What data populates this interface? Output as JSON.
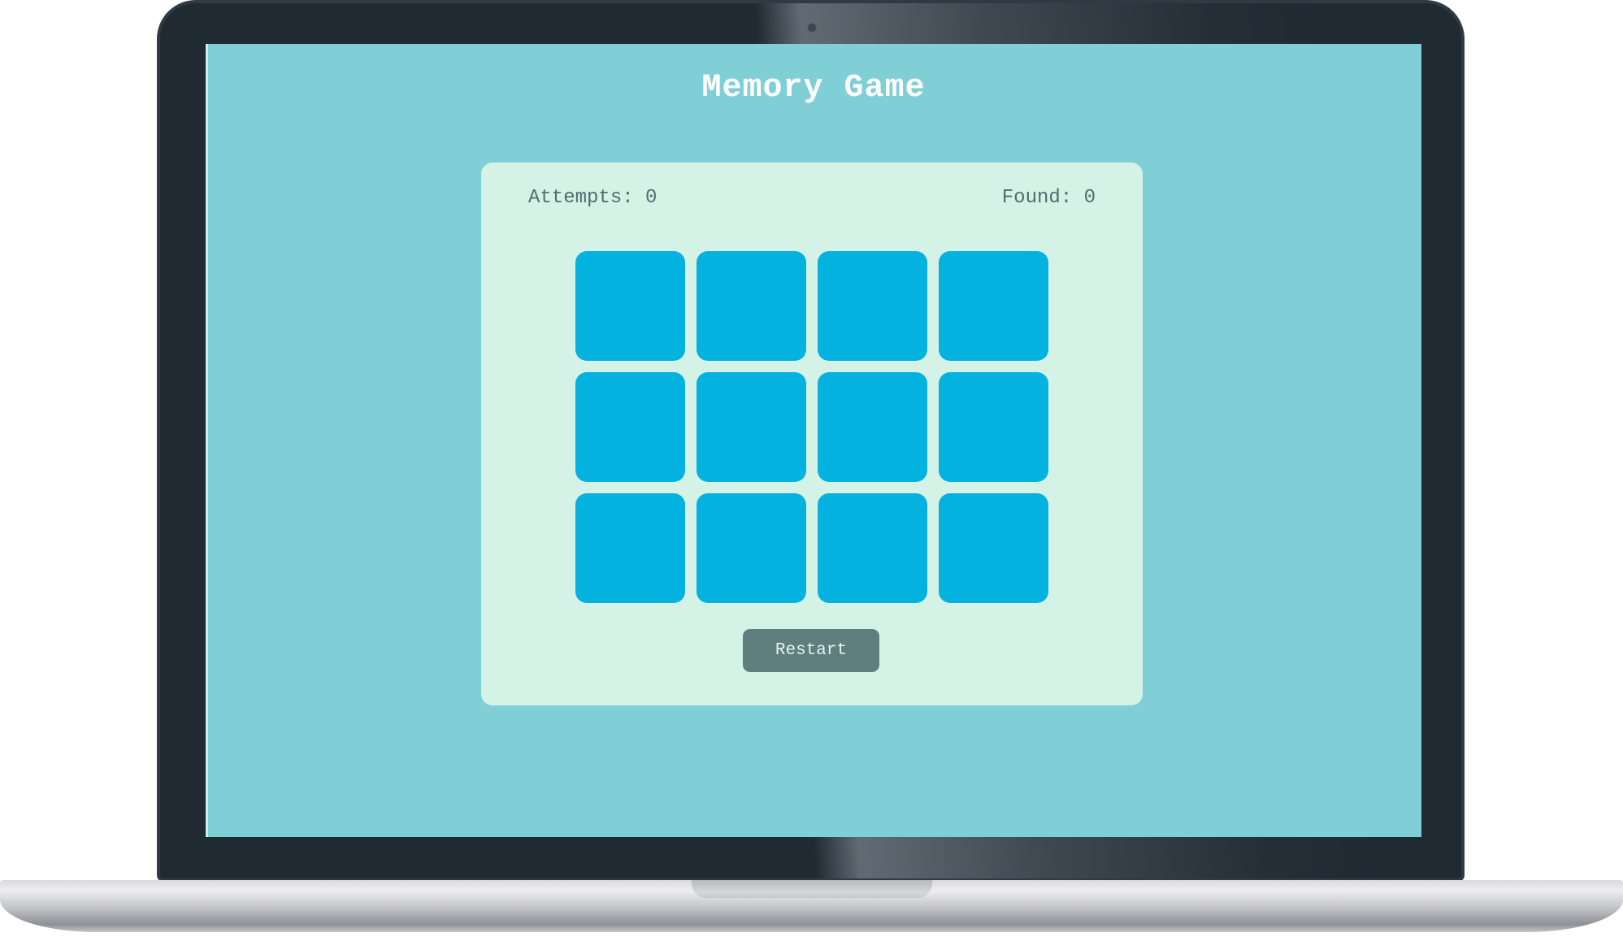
{
  "app": {
    "title": "Memory Game"
  },
  "stats": {
    "attempts_label": "Attempts: 0",
    "found_label": "Found: 0"
  },
  "board": {
    "rows": 3,
    "columns": 4,
    "cards": [
      {
        "state": "face-down"
      },
      {
        "state": "face-down"
      },
      {
        "state": "face-down"
      },
      {
        "state": "face-down"
      },
      {
        "state": "face-down"
      },
      {
        "state": "face-down"
      },
      {
        "state": "face-down"
      },
      {
        "state": "face-down"
      },
      {
        "state": "face-down"
      },
      {
        "state": "face-down"
      },
      {
        "state": "face-down"
      },
      {
        "state": "face-down"
      }
    ]
  },
  "controls": {
    "restart_label": "Restart"
  },
  "colors": {
    "screen_background": "#80cfd6",
    "board_background": "#d5f2e6",
    "card_back": "#04b2e0",
    "button_background": "#5f7f7f",
    "stat_text": "#4f6e6e",
    "title_text": "#ffffff"
  }
}
